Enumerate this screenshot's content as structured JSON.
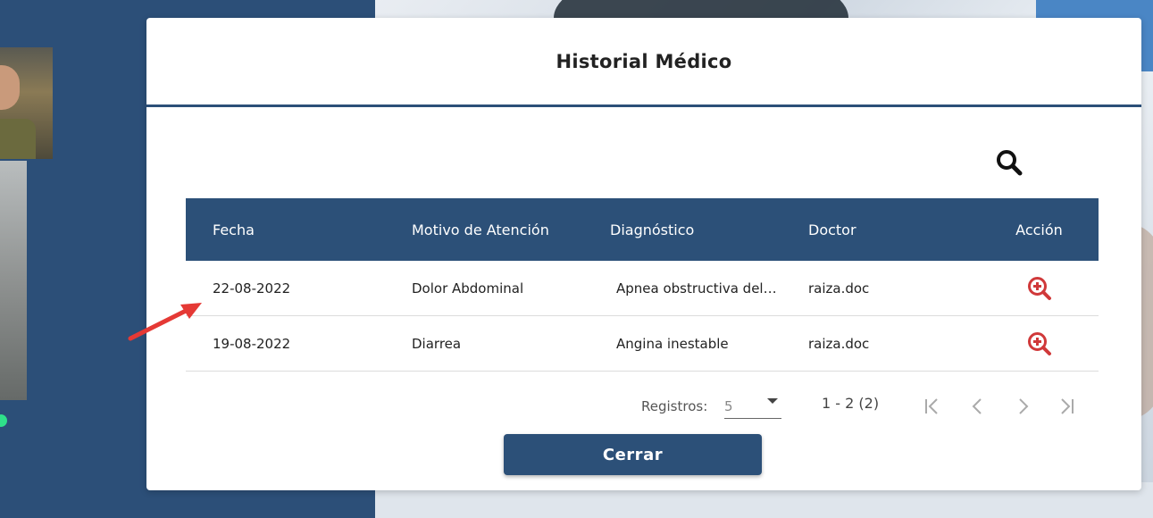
{
  "modal": {
    "title": "Historial Médico",
    "close_label": "Cerrar"
  },
  "table": {
    "headers": [
      "Fecha",
      "Motivo de Atención",
      "Diagnóstico",
      "Doctor",
      "Acción"
    ],
    "rows": [
      {
        "fecha": "22-08-2022",
        "motivo": "Dolor Abdominal",
        "diagnostico": "Apnea obstructiva del…",
        "doctor": "raiza.doc",
        "action_icon": "zoom-in-icon"
      },
      {
        "fecha": "19-08-2022",
        "motivo": "Diarrea",
        "diagnostico": "Angina inestable",
        "doctor": "raiza.doc",
        "action_icon": "zoom-in-icon"
      }
    ]
  },
  "paginator": {
    "registros_label": "Registros:",
    "page_size": "5",
    "range": "1 - 2 (2)"
  },
  "colors": {
    "primary": "#2c5078",
    "action_icon": "#d0393a",
    "annotation_arrow": "#e53935"
  }
}
